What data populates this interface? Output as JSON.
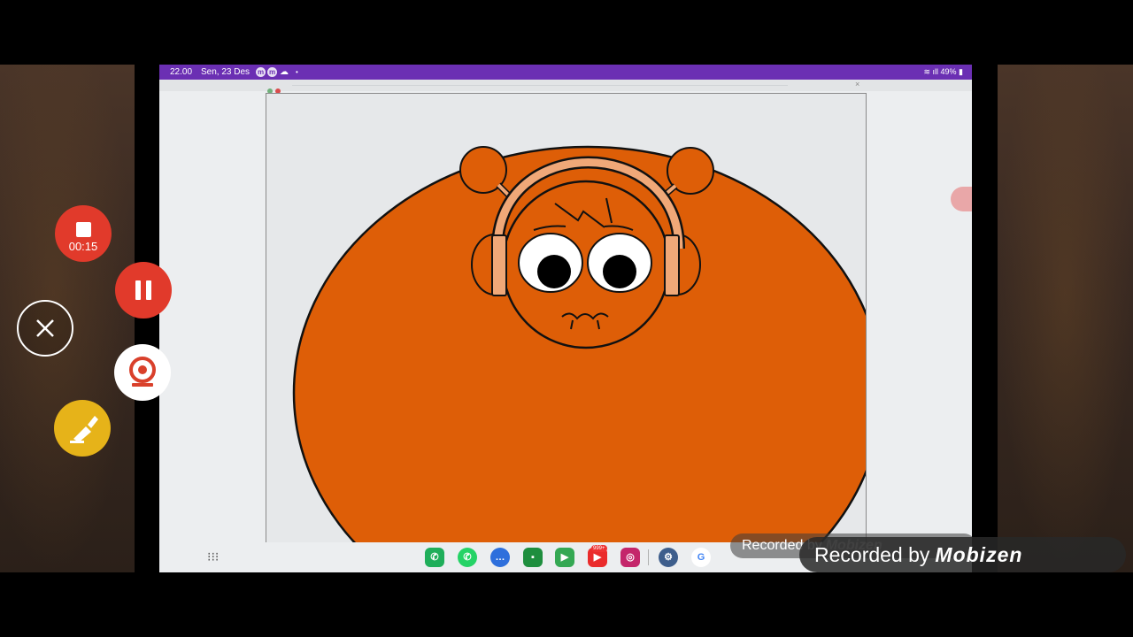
{
  "status_bar": {
    "time": "22.00",
    "date": "Sen, 23 Des",
    "right": "49%"
  },
  "recorder": {
    "elapsed": "00:15"
  },
  "dock": {
    "badge": "999+",
    "apps": [
      "phone-icon",
      "whatsapp-icon",
      "messages-icon",
      "classroom-icon",
      "meet-icon",
      "youtube-icon",
      "instagram-icon",
      "settings-icon",
      "google-icon"
    ]
  },
  "watermark": {
    "label": "Recorded by",
    "brand": "Mobizen"
  },
  "colors": {
    "status_bar": "#6b2fb3",
    "character": "#de5e07",
    "recorder": "#e13a2b",
    "draw": "#e6b319"
  }
}
